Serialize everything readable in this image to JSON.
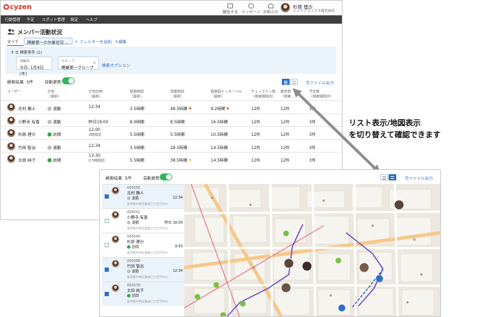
{
  "main_window": {
    "logo": "cyzen",
    "header_buttons": [
      {
        "label": "報告する",
        "icon": "report-icon"
      },
      {
        "label": "メッセージ",
        "icon": "message-icon"
      },
      {
        "label": "お知らせ",
        "icon": "bell-icon"
      }
    ],
    "user": {
      "name": "杉原 理沙",
      "company": "レッドフォックス株式会社"
    },
    "nav": [
      "行動管理",
      "予定",
      "スポット管理",
      "設定",
      "ヘルプ"
    ],
    "page_title": "メンバー活動状況",
    "filter_tab_all": "すべて",
    "filter_tab_saved": "開業第一の作業状況",
    "filter_tab_more": "…",
    "add_filter": "+ フィルターを追加",
    "edit": "編集",
    "conditions_label": "検索条件 (2)",
    "condition_date": {
      "label": "活動日",
      "value": "今日: 1月4日(木)"
    },
    "condition_group": {
      "label": "グループ",
      "value": "開業第一グループ",
      "clear": "×"
    },
    "search_options": "検索オプション",
    "result_label": "検索結果",
    "result_count": "5件",
    "auto_update": "自動更新",
    "export": "ファイル出力",
    "columns": [
      {
        "line1": "ユーザー",
        "line2": ""
      },
      {
        "line1": "打刻",
        "line2": "（最新）"
      },
      {
        "line1": "打刻日時",
        "line2": "（最新）"
      },
      {
        "line1": "勤務時間",
        "line2": "（最新）"
      },
      {
        "line1": "残業時間",
        "line2": "（最新）"
      },
      {
        "line1": "勤務間インターバル",
        "line2": "（最新）"
      },
      {
        "line1": "チェックイン数",
        "line2": "（検索期間内）"
      },
      {
        "line1": "報告数",
        "line2": "（検索…"
      },
      {
        "line1": "予定数",
        "line2": "（検索期間内）"
      }
    ],
    "rows": [
      {
        "user": "北村 勝人",
        "status": "退勤",
        "status_type": "grey",
        "time": "12:34",
        "time2": "",
        "work": "3.5時間",
        "overtime": "48.5時間",
        "ot_dot": "#e0502f",
        "interval": "9.2時間",
        "int_dot": "#e0502f",
        "checkins": "12件",
        "reports": "12件",
        "plans": "3件"
      },
      {
        "user": "小野寺 有香",
        "status": "退勤",
        "status_type": "grey",
        "time": "昨日18:00",
        "time2": "",
        "work": "8.0時間",
        "overtime": "8.5時間",
        "ot_dot": "",
        "interval": "16.5時間",
        "int_dot": "",
        "checkins": "12件",
        "reports": "12件",
        "plans": "3件"
      },
      {
        "user": "杉原 理沙",
        "status": "訪問",
        "status_type": "green",
        "time": "12:00",
        "time2": "2時間前",
        "work": "5.5時間",
        "overtime": "5.5時間",
        "ot_dot": "",
        "interval": "10.5時間",
        "int_dot": "",
        "checkins": "12件",
        "reports": "12件",
        "plans": "3件"
      },
      {
        "user": "竹田 智治",
        "status": "退勤",
        "status_type": "grey",
        "time": "12:34",
        "time2": "",
        "work": "3.5時間",
        "overtime": "28.5時間",
        "ot_dot": "",
        "interval": "14.5時間",
        "int_dot": "",
        "checkins": "12件",
        "reports": "12件",
        "plans": "3件"
      },
      {
        "user": "太田 純子",
        "status": "訪問",
        "status_type": "green",
        "time": "13:30",
        "time2": "0.5時間前",
        "work": "5.5時間",
        "overtime": "38.5時間",
        "ot_dot": "#f0b429",
        "interval": "14.5時間",
        "int_dot": "",
        "checkins": "12件",
        "reports": "12件",
        "plans": "3件"
      }
    ]
  },
  "caption": {
    "line1": "リスト表示/地図表示",
    "line2": "を切り替えて確認できます"
  },
  "map_window": {
    "result_label": "検索結果",
    "result_count": "5件",
    "auto_update": "自動更新",
    "export": "ファイル出力",
    "members": [
      {
        "id": "000090",
        "name": "北村 勝人",
        "status": "退勤",
        "status_type": "grey",
        "time": "12:34",
        "address": "東京都中央区銀座〇丁目7(5m)",
        "selected": true
      },
      {
        "id": "000092",
        "name": "小野寺 有香",
        "status": "退勤",
        "status_type": "grey",
        "time": "昨日 18:00",
        "address": "東京都中央区銀座〇丁目7(5m)",
        "selected": false
      },
      {
        "id": "000040",
        "name": "杉原 理沙",
        "status": "訪問",
        "status_type": "green",
        "time": "9:55",
        "address": "東京都中央区銀座〇丁目7(5m)",
        "selected": false
      },
      {
        "id": "000098",
        "name": "竹田 智治",
        "status": "退勤",
        "status_type": "grey",
        "time": "12:34",
        "address": "東京都中央区銀座〇丁目7(5m)",
        "selected": true
      },
      {
        "id": "000078",
        "name": "太田 純子",
        "status": "訪問",
        "status_type": "green",
        "time": "",
        "address": "東京都中央区銀座〇丁目7(5m)",
        "selected": true
      }
    ]
  },
  "colors": {
    "brand_red": "#d9362b",
    "accent_blue": "#2e6fc2",
    "toggle_green": "#2fb55a",
    "route_purple": "#6b4bc7",
    "route_blue": "#2e6fc2",
    "nav_bg": "#3e3e3e",
    "arrow_grey": "#8e8e8e"
  }
}
